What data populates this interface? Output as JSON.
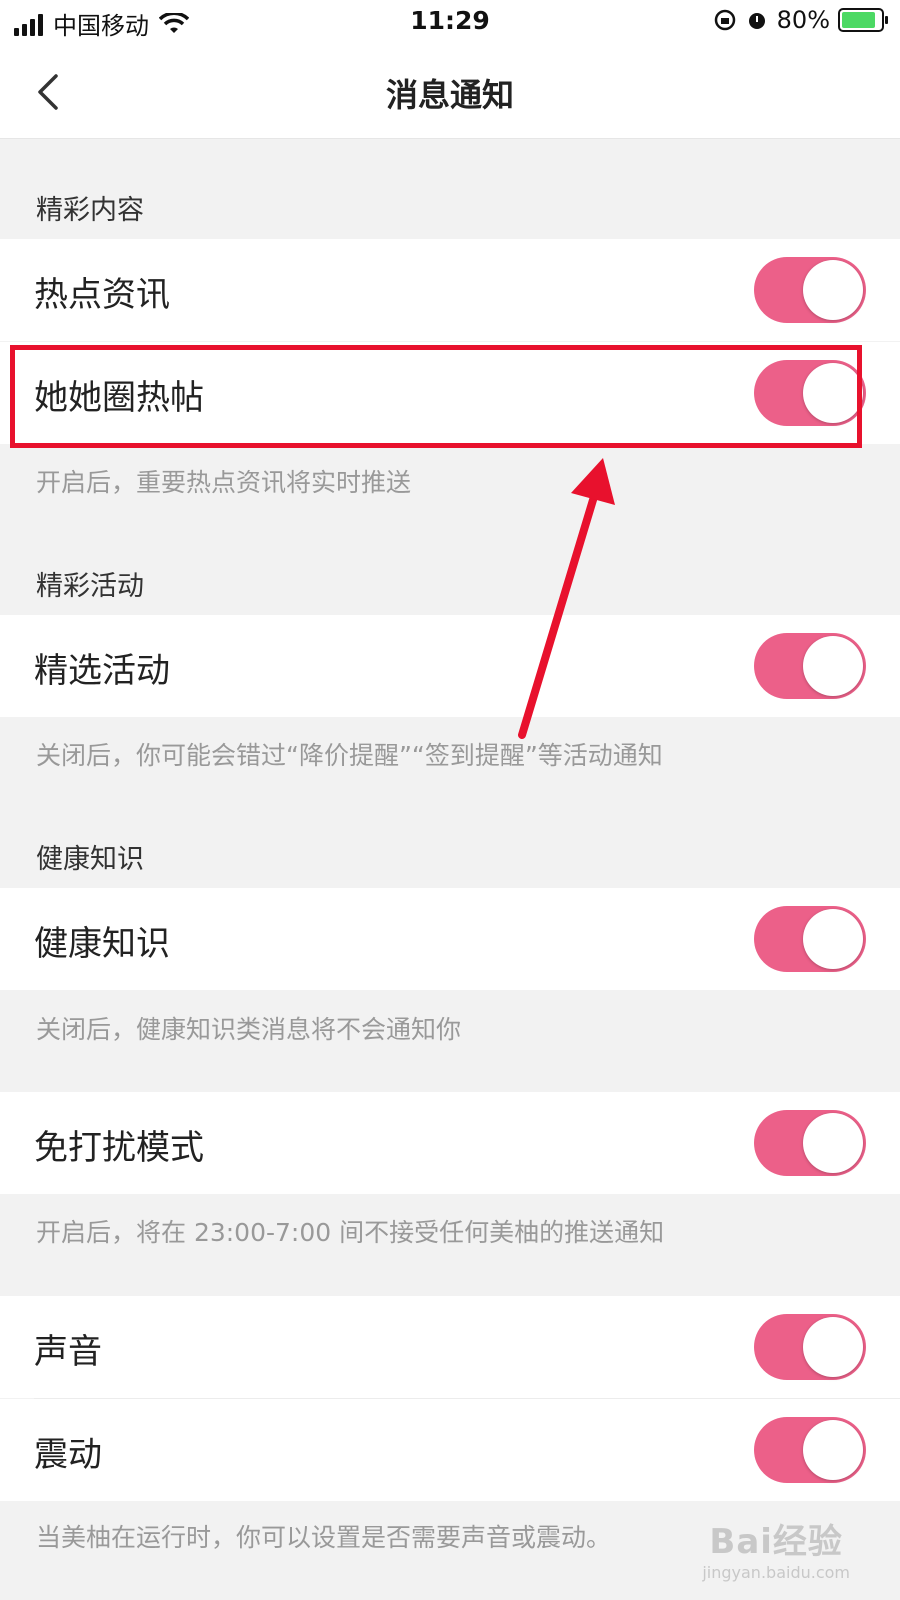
{
  "status_bar": {
    "carrier": "中国移动",
    "time": "11:29",
    "battery": "80%",
    "icons": [
      "signal-icon",
      "wifi-icon",
      "rotation-lock-icon",
      "alarm-icon",
      "battery-charging-icon"
    ]
  },
  "nav": {
    "title": "消息通知",
    "back_icon": "chevron-left-icon"
  },
  "sections": {
    "content_label": "精彩内容",
    "activity_label": "精彩活动",
    "health_label": "健康知识"
  },
  "rows": {
    "hot_news": {
      "label": "热点资讯",
      "on": true
    },
    "circle_posts": {
      "label": "她她圈热帖",
      "on": true
    },
    "selected_activities": {
      "label": "精选活动",
      "on": true
    },
    "health_knowledge": {
      "label": "健康知识",
      "on": true
    },
    "dnd_mode": {
      "label": "免打扰模式",
      "on": true
    },
    "sound": {
      "label": "声音",
      "on": true
    },
    "vibrate": {
      "label": "震动",
      "on": true
    }
  },
  "hints": {
    "content": "开启后，重要热点资讯将实时推送",
    "activity": "关闭后，你可能会错过“降价提醒”“签到提醒”等活动通知",
    "health": "关闭后，健康知识类消息将不会通知你",
    "dnd": "开启后，将在 23:00-7:00 间不接受任何美柚的推送通知",
    "sound": "当美柚在运行时，你可以设置是否需要声音或震动。"
  },
  "colors": {
    "toggle_on": "#ec6089",
    "highlight": "#e8112d"
  },
  "watermark": {
    "top": "Bai经验",
    "bottom": "jingyan.baidu.com"
  }
}
